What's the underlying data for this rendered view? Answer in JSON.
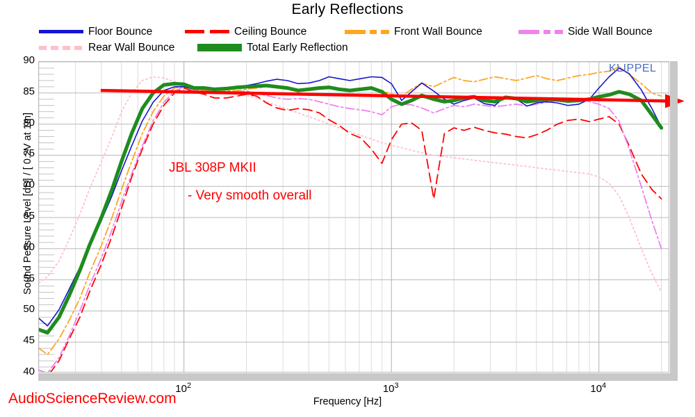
{
  "header": {
    "title": "Early Reflections"
  },
  "watermarks": {
    "site": "AudioScienceReview.com",
    "device": "KLIPPEL"
  },
  "annotations": {
    "model": "JBL 308P MKII",
    "note": "- Very smooth overall"
  },
  "legend": {
    "items": [
      {
        "label": "Floor Bounce",
        "color": "#1414d2",
        "style": "solid"
      },
      {
        "label": "Ceiling Bounce",
        "color": "#ff0000",
        "style": "long-dash"
      },
      {
        "label": "Front Wall Bounce",
        "color": "#ffa51e",
        "style": "dash-dot"
      },
      {
        "label": "Side Wall Bounce",
        "color": "#ee82ee",
        "style": "dash-dot"
      },
      {
        "label": "Rear Wall Bounce",
        "color": "#ffc0cb",
        "style": "dotted"
      },
      {
        "label": "Total Early Reflection",
        "color": "#1e8c1e",
        "style": "solid-thick"
      }
    ]
  },
  "chart_data": {
    "type": "line",
    "title": "Early Reflections",
    "xlabel": "Frequency [Hz]",
    "ylabel": "Sound Pessure Level [dB]  /  [ 0.2V at 1m]",
    "xscale": "log",
    "xlim": [
      20,
      22000
    ],
    "ylim": [
      40,
      90
    ],
    "yticks": [
      40,
      45,
      50,
      55,
      60,
      65,
      70,
      75,
      80,
      85,
      90
    ],
    "xticks": [
      100,
      1000,
      10000
    ],
    "xtick_labels": [
      "10 2",
      "10 3",
      "10 4"
    ],
    "grid": true,
    "legend_position": "top",
    "trend_line": {
      "color": "#ff0000",
      "label": "smoothness trend arrow",
      "x": [
        40,
        22000
      ],
      "y": [
        85.3,
        83.6
      ]
    },
    "x": [
      20,
      22,
      25,
      28,
      31.5,
      35,
      40,
      45,
      50,
      56,
      63,
      71,
      80,
      90,
      100,
      112,
      125,
      140,
      160,
      180,
      200,
      224,
      250,
      280,
      315,
      355,
      400,
      450,
      500,
      560,
      630,
      710,
      800,
      900,
      1000,
      1120,
      1250,
      1400,
      1600,
      1800,
      2000,
      2240,
      2500,
      2800,
      3150,
      3550,
      4000,
      4500,
      5000,
      5600,
      6300,
      7100,
      8000,
      9000,
      10000,
      11200,
      12500,
      14000,
      16000,
      18000,
      20000
    ],
    "series": [
      {
        "name": "Floor Bounce",
        "color": "#1414d2",
        "style": "solid",
        "values": [
          48.8,
          47.6,
          50.2,
          53.5,
          57.0,
          60.5,
          64.5,
          68.5,
          72.5,
          76.5,
          80.5,
          83.5,
          85.4,
          86.0,
          86.0,
          85.6,
          85.6,
          85.4,
          85.6,
          86.0,
          86.2,
          86.5,
          86.9,
          87.2,
          87.0,
          86.5,
          86.6,
          87.0,
          87.6,
          87.3,
          87.0,
          87.3,
          87.6,
          87.5,
          86.5,
          83.8,
          85.2,
          86.6,
          85.3,
          84.0,
          83.2,
          83.8,
          84.2,
          83.3,
          83.0,
          84.5,
          84.0,
          82.9,
          83.4,
          83.6,
          83.4,
          83.0,
          83.2,
          84.0,
          85.8,
          87.6,
          89.0,
          88.1,
          85.5,
          82.5,
          79.5
        ]
      },
      {
        "name": "Ceiling Bounce",
        "color": "#ff0000",
        "style": "long-dash",
        "values": [
          38.5,
          39.5,
          42.0,
          45.5,
          49.0,
          53.0,
          57.5,
          62.0,
          66.5,
          71.5,
          76.0,
          80.0,
          83.0,
          85.0,
          85.8,
          85.2,
          84.8,
          84.2,
          84.2,
          84.5,
          84.8,
          84.5,
          83.4,
          82.6,
          82.2,
          82.5,
          82.3,
          81.8,
          80.7,
          79.8,
          78.5,
          77.8,
          76.0,
          73.7,
          77.5,
          80.0,
          80.2,
          79.0,
          68.0,
          78.5,
          79.4,
          79.0,
          79.5,
          79.0,
          78.6,
          78.4,
          78.0,
          77.8,
          78.3,
          79.0,
          80.0,
          80.6,
          80.8,
          80.4,
          80.8,
          81.2,
          80.0,
          76.5,
          72.0,
          69.5,
          68.0
        ]
      },
      {
        "name": "Front Wall Bounce",
        "color": "#ffa51e",
        "style": "dash-dot",
        "values": [
          44.0,
          43.0,
          45.5,
          48.5,
          52.0,
          56.0,
          60.5,
          65.0,
          69.5,
          74.0,
          78.5,
          82.0,
          84.5,
          85.8,
          86.0,
          85.5,
          85.4,
          85.2,
          85.3,
          85.4,
          85.6,
          85.8,
          86.0,
          85.8,
          85.6,
          85.4,
          85.6,
          85.8,
          86.0,
          85.7,
          85.5,
          85.6,
          85.8,
          85.4,
          84.8,
          84.5,
          85.6,
          86.6,
          86.0,
          86.8,
          87.5,
          87.0,
          86.8,
          87.2,
          87.6,
          87.3,
          87.0,
          87.4,
          87.8,
          87.3,
          87.0,
          87.4,
          87.8,
          88.0,
          88.3,
          88.5,
          89.2,
          88.0,
          86.5,
          85.0,
          84.5
        ]
      },
      {
        "name": "Side Wall Bounce",
        "color": "#ee82ee",
        "style": "dash-dot",
        "values": [
          40.5,
          40.0,
          42.5,
          46.0,
          50.0,
          54.0,
          58.5,
          63.0,
          67.5,
          72.0,
          76.5,
          80.5,
          83.5,
          85.3,
          86.0,
          85.4,
          85.2,
          84.9,
          85.0,
          85.2,
          85.3,
          85.0,
          84.6,
          84.2,
          84.0,
          84.1,
          84.0,
          83.6,
          83.2,
          82.8,
          82.5,
          82.3,
          82.0,
          81.5,
          82.8,
          83.2,
          83.1,
          82.6,
          81.8,
          82.5,
          83.0,
          82.8,
          83.2,
          83.0,
          82.8,
          83.0,
          83.2,
          82.9,
          83.2,
          83.5,
          83.7,
          83.9,
          84.0,
          83.6,
          83.2,
          82.5,
          80.5,
          76.0,
          70.0,
          64.5,
          60.0
        ]
      },
      {
        "name": "Rear Wall Bounce",
        "color": "#ffc0cb",
        "style": "dotted",
        "values": [
          54.5,
          55.5,
          58.0,
          61.5,
          65.5,
          69.5,
          74.0,
          78.0,
          82.0,
          85.0,
          87.0,
          87.6,
          87.4,
          86.8,
          86.2,
          85.6,
          85.4,
          85.2,
          85.0,
          84.8,
          84.6,
          84.2,
          83.6,
          83.0,
          82.4,
          81.8,
          81.2,
          80.6,
          80.0,
          79.4,
          78.8,
          78.2,
          77.6,
          77.0,
          76.6,
          76.2,
          75.8,
          75.4,
          75.0,
          74.8,
          74.6,
          74.4,
          74.2,
          74.0,
          73.8,
          73.6,
          73.4,
          73.2,
          73.0,
          72.8,
          72.6,
          72.4,
          72.2,
          72.0,
          71.5,
          70.5,
          68.5,
          65.0,
          60.0,
          56.0,
          53.0
        ]
      },
      {
        "name": "Total Early Reflection",
        "color": "#1e8c1e",
        "style": "solid-thick",
        "values": [
          47.0,
          46.5,
          49.0,
          52.5,
          56.5,
          60.5,
          65.0,
          69.5,
          74.0,
          78.5,
          82.5,
          85.0,
          86.3,
          86.5,
          86.4,
          85.8,
          85.8,
          85.6,
          85.7,
          85.9,
          86.0,
          86.1,
          86.2,
          86.0,
          85.8,
          85.4,
          85.6,
          85.8,
          85.9,
          85.6,
          85.4,
          85.6,
          85.8,
          85.2,
          84.0,
          83.2,
          83.8,
          84.6,
          84.0,
          83.6,
          83.8,
          84.2,
          84.4,
          83.8,
          83.6,
          84.3,
          84.1,
          83.6,
          83.8,
          84.0,
          83.9,
          83.7,
          83.8,
          84.0,
          84.4,
          84.7,
          85.2,
          84.8,
          83.8,
          81.5,
          79.4
        ]
      }
    ]
  }
}
